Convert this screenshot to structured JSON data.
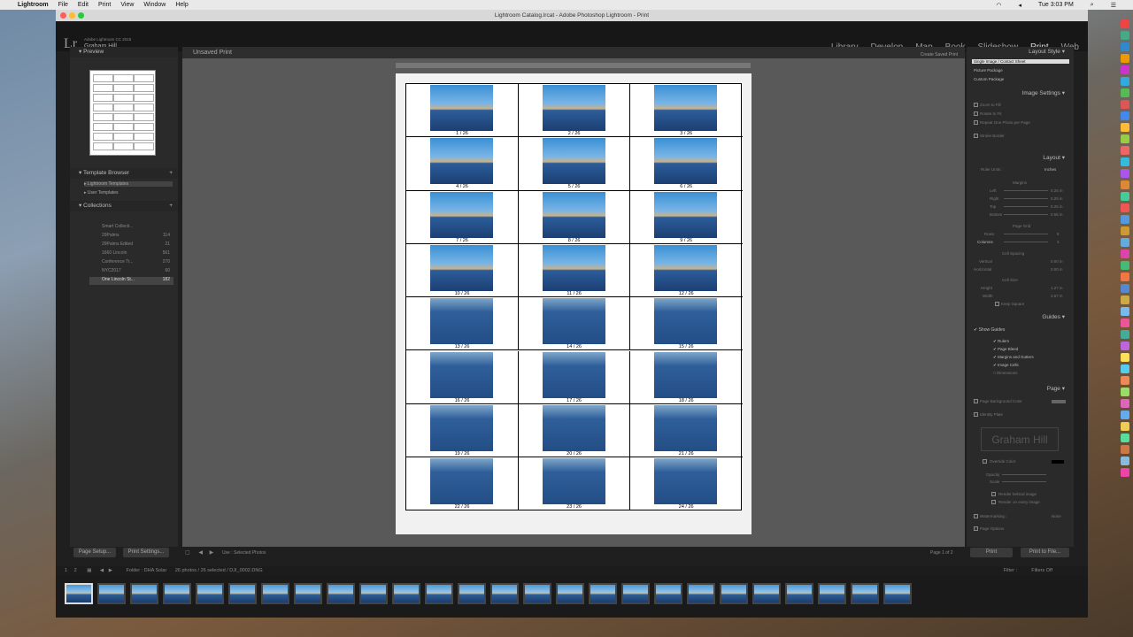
{
  "menubar": {
    "items": [
      "Lightroom",
      "File",
      "Edit",
      "Print",
      "View",
      "Window",
      "Help"
    ],
    "clock": "Tue 3:03 PM"
  },
  "window": {
    "title": "Lightroom Catalog.lrcat - Adobe Photoshop Lightroom - Print"
  },
  "identity": {
    "logo": "Lr",
    "product": "Adobe Lightroom CC 2015",
    "name": "Graham Hill"
  },
  "modules": [
    "Library",
    "Develop",
    "Map",
    "Book",
    "Slideshow",
    "Print",
    "Web"
  ],
  "left": {
    "preview_label": "Preview",
    "template_browser_label": "Template Browser",
    "templates": [
      "Lightroom Templates",
      "User Templates"
    ],
    "collections_label": "Collections",
    "collections": [
      {
        "name": "Smart Collecti...",
        "count": ""
      },
      {
        "name": "29Palms",
        "count": "114"
      },
      {
        "name": "29Palms Edited",
        "count": "21"
      },
      {
        "name": "1660 Lincoln",
        "count": "561"
      },
      {
        "name": "Conference Tr...",
        "count": "270"
      },
      {
        "name": "NYC2017",
        "count": "60"
      },
      {
        "name": "One Lincoln St...",
        "count": "182"
      }
    ],
    "page_setup": "Page Setup...",
    "print_settings": "Print Settings..."
  },
  "center": {
    "title": "Unsaved Print",
    "save_btn": "Create Saved Print",
    "use_label": "Use : Selected Photos",
    "page_count": "Page 1 of 2",
    "captions": [
      "1 / 26",
      "2 / 26",
      "3 / 26",
      "4 / 26",
      "5 / 26",
      "6 / 26",
      "7 / 26",
      "8 / 26",
      "9 / 26",
      "10 / 26",
      "11 / 26",
      "12 / 26",
      "13 / 26",
      "14 / 26",
      "15 / 26",
      "16 / 26",
      "17 / 26",
      "18 / 26",
      "19 / 26",
      "20 / 26",
      "21 / 26",
      "22 / 26",
      "23 / 26",
      "24 / 26"
    ]
  },
  "right": {
    "layout_style": "Layout Style",
    "styles": [
      "Single Image / Contact Sheet",
      "Picture Package",
      "Custom Package"
    ],
    "image_settings": "Image Settings",
    "img_opts": [
      "Zoom to Fill",
      "Rotate to Fit",
      "Repeat One Photo per Page",
      "Stroke Border"
    ],
    "layout": "Layout",
    "ruler_units": "Ruler Units :",
    "inches": "Inches",
    "margins": "Margins",
    "margin_rows": [
      {
        "l": "Left",
        "v": "0.25 in"
      },
      {
        "l": "Right",
        "v": "0.25 in"
      },
      {
        "l": "Top",
        "v": "0.25 in"
      },
      {
        "l": "Bottom",
        "v": "0.56 in"
      }
    ],
    "page_grid": "Page Grid",
    "rows": "Rows",
    "rows_v": "8",
    "columns": "Columns",
    "columns_v": "3",
    "cell_spacing": "Cell Spacing",
    "vertical": "Vertical",
    "vertical_v": "0.00 in",
    "horizontal": "Horizontal",
    "horizontal_v": "0.00 in",
    "cell_size": "Cell Size",
    "height": "Height",
    "height_v": "1.27 in",
    "width": "Width",
    "width_v": "2.67 in",
    "keep_square": "Keep Square",
    "guides": "Guides",
    "show_guides": "Show Guides",
    "guide_opts": [
      "Rulers",
      "Page Bleed",
      "Margins and Gutters",
      "Image Cells",
      "Dimensions"
    ],
    "page": "Page",
    "page_bg": "Page Background Color",
    "identity_plate": "Identity Plate",
    "plate_text": "Graham Hill",
    "override": "Override Color",
    "opacity": "Opacity",
    "scale": "Scale",
    "render_behind": "Render behind image",
    "render_every": "Render on every image",
    "watermarking": "Watermarking :",
    "watermark_v": "None",
    "page_options": "Page Options",
    "print_btn": "Print",
    "print_file_btn": "Print to File..."
  },
  "filmstrip": {
    "folder": "Folder : DHA Solar",
    "count": "26 photos / 26 selected / DJI_0002.DNG",
    "filter": "Filter :",
    "filter_v": "Filters Off",
    "thumbs": 26
  }
}
